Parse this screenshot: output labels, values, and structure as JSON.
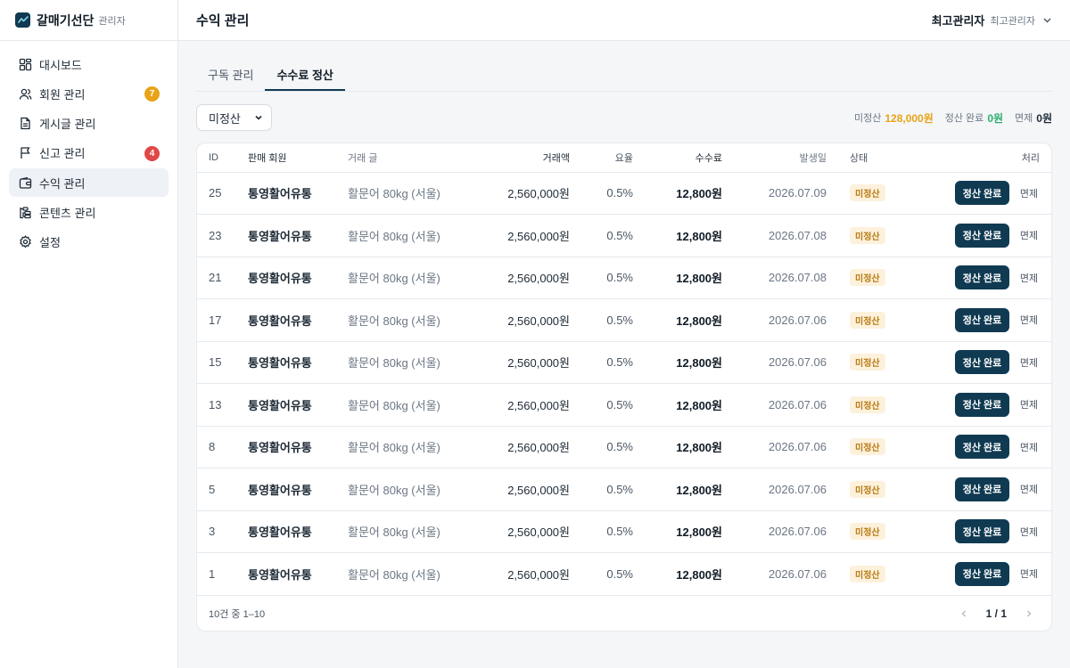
{
  "brand": {
    "name": "갈매기선단",
    "sub": "관리자"
  },
  "colors": {
    "accent": "#103a52",
    "badge_orange": "#e8a317",
    "badge_red": "#e04848",
    "unsettled": "#e8a317",
    "settled": "#2fae6e"
  },
  "sidebar": {
    "items": [
      {
        "label": "대시보드",
        "icon": "dashboard-icon",
        "active": false,
        "badge": null
      },
      {
        "label": "회원 관리",
        "icon": "users-icon",
        "active": false,
        "badge": "7"
      },
      {
        "label": "게시글 관리",
        "icon": "document-icon",
        "active": false,
        "badge": null
      },
      {
        "label": "신고 관리",
        "icon": "flag-icon",
        "active": false,
        "badge": "4"
      },
      {
        "label": "수익 관리",
        "icon": "wallet-icon",
        "active": true,
        "badge": null
      },
      {
        "label": "콘텐츠 관리",
        "icon": "content-icon",
        "active": false,
        "badge": null
      },
      {
        "label": "설정",
        "icon": "gear-icon",
        "active": false,
        "badge": null
      }
    ]
  },
  "header": {
    "title": "수익 관리",
    "user_name": "최고관리자",
    "user_role": "최고관리자"
  },
  "tabs": [
    {
      "label": "구독 관리",
      "active": false
    },
    {
      "label": "수수료 정산",
      "active": true
    }
  ],
  "filter": {
    "selected": "미정산"
  },
  "summary": {
    "unsettled_label": "미정산",
    "unsettled_value": "128,000원",
    "settled_label": "정산 완료",
    "settled_value": "0원",
    "waived_label": "면제",
    "waived_value": "0원"
  },
  "table": {
    "columns": [
      "ID",
      "판매 회원",
      "거래 글",
      "거래액",
      "요율",
      "수수료",
      "발생일",
      "상태",
      "처리"
    ],
    "settle_label": "정산 완료",
    "waive_label": "면제",
    "rows": [
      {
        "id": "25",
        "seller": "통영활어유통",
        "item": "활문어 80kg (서울)",
        "amount": "2,560,000원",
        "rate": "0.5%",
        "fee": "12,800원",
        "date": "2026.07.09",
        "status": "미정산"
      },
      {
        "id": "23",
        "seller": "통영활어유통",
        "item": "활문어 80kg (서울)",
        "amount": "2,560,000원",
        "rate": "0.5%",
        "fee": "12,800원",
        "date": "2026.07.08",
        "status": "미정산"
      },
      {
        "id": "21",
        "seller": "통영활어유통",
        "item": "활문어 80kg (서울)",
        "amount": "2,560,000원",
        "rate": "0.5%",
        "fee": "12,800원",
        "date": "2026.07.08",
        "status": "미정산"
      },
      {
        "id": "17",
        "seller": "통영활어유통",
        "item": "활문어 80kg (서울)",
        "amount": "2,560,000원",
        "rate": "0.5%",
        "fee": "12,800원",
        "date": "2026.07.06",
        "status": "미정산"
      },
      {
        "id": "15",
        "seller": "통영활어유통",
        "item": "활문어 80kg (서울)",
        "amount": "2,560,000원",
        "rate": "0.5%",
        "fee": "12,800원",
        "date": "2026.07.06",
        "status": "미정산"
      },
      {
        "id": "13",
        "seller": "통영활어유통",
        "item": "활문어 80kg (서울)",
        "amount": "2,560,000원",
        "rate": "0.5%",
        "fee": "12,800원",
        "date": "2026.07.06",
        "status": "미정산"
      },
      {
        "id": "8",
        "seller": "통영활어유통",
        "item": "활문어 80kg (서울)",
        "amount": "2,560,000원",
        "rate": "0.5%",
        "fee": "12,800원",
        "date": "2026.07.06",
        "status": "미정산"
      },
      {
        "id": "5",
        "seller": "통영활어유통",
        "item": "활문어 80kg (서울)",
        "amount": "2,560,000원",
        "rate": "0.5%",
        "fee": "12,800원",
        "date": "2026.07.06",
        "status": "미정산"
      },
      {
        "id": "3",
        "seller": "통영활어유통",
        "item": "활문어 80kg (서울)",
        "amount": "2,560,000원",
        "rate": "0.5%",
        "fee": "12,800원",
        "date": "2026.07.06",
        "status": "미정산"
      },
      {
        "id": "1",
        "seller": "통영활어유통",
        "item": "활문어 80kg (서울)",
        "amount": "2,560,000원",
        "rate": "0.5%",
        "fee": "12,800원",
        "date": "2026.07.06",
        "status": "미정산"
      }
    ]
  },
  "pagination": {
    "range_text": "10건 중 1–10",
    "page": "1 / 1"
  }
}
